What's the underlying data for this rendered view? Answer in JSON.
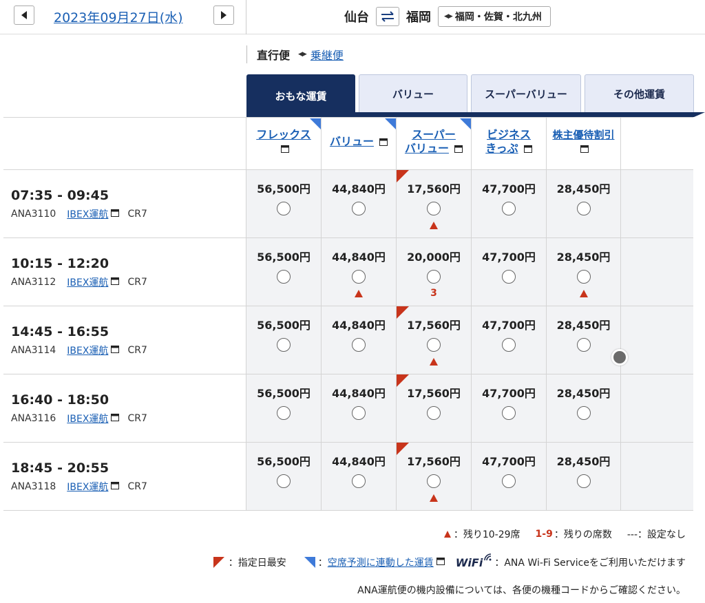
{
  "header": {
    "date": "2023年09月27日(水)",
    "origin": "仙台",
    "destination": "福岡",
    "area_option": "福岡・佐賀・北九州"
  },
  "flight_type": {
    "direct": "直行便",
    "transfer": "乗継便"
  },
  "tabs": [
    "おもな運賃",
    "バリュー",
    "スーパーバリュー",
    "その他運賃"
  ],
  "fare_headers": [
    {
      "line1": "フレックス",
      "line2": ""
    },
    {
      "line1": "バリュー",
      "line2": ""
    },
    {
      "line1": "スーパー",
      "line2": "バリュー"
    },
    {
      "line1": "ビジネス",
      "line2": "きっぷ"
    },
    {
      "line1": "株主優待割引",
      "line2": ""
    }
  ],
  "flights": [
    {
      "time": "07:35 - 09:45",
      "flight_no": "ANA3110",
      "operator": "IBEX運航",
      "aircraft": "CR7",
      "fares": [
        {
          "price": "56,500円",
          "mark": ""
        },
        {
          "price": "44,840円",
          "mark": ""
        },
        {
          "price": "17,560円",
          "mark": "triangle",
          "lowest": true
        },
        {
          "price": "47,700円",
          "mark": ""
        },
        {
          "price": "28,450円",
          "mark": ""
        }
      ]
    },
    {
      "time": "10:15 - 12:20",
      "flight_no": "ANA3112",
      "operator": "IBEX運航",
      "aircraft": "CR7",
      "fares": [
        {
          "price": "56,500円",
          "mark": ""
        },
        {
          "price": "44,840円",
          "mark": "triangle"
        },
        {
          "price": "20,000円",
          "mark": "3"
        },
        {
          "price": "47,700円",
          "mark": ""
        },
        {
          "price": "28,450円",
          "mark": "triangle"
        }
      ]
    },
    {
      "time": "14:45 - 16:55",
      "flight_no": "ANA3114",
      "operator": "IBEX運航",
      "aircraft": "CR7",
      "fares": [
        {
          "price": "56,500円",
          "mark": ""
        },
        {
          "price": "44,840円",
          "mark": ""
        },
        {
          "price": "17,560円",
          "mark": "triangle",
          "lowest": true
        },
        {
          "price": "47,700円",
          "mark": ""
        },
        {
          "price": "28,450円",
          "mark": ""
        }
      ]
    },
    {
      "time": "16:40 - 18:50",
      "flight_no": "ANA3116",
      "operator": "IBEX運航",
      "aircraft": "CR7",
      "fares": [
        {
          "price": "56,500円",
          "mark": ""
        },
        {
          "price": "44,840円",
          "mark": ""
        },
        {
          "price": "17,560円",
          "mark": "",
          "lowest": true
        },
        {
          "price": "47,700円",
          "mark": ""
        },
        {
          "price": "28,450円",
          "mark": ""
        }
      ]
    },
    {
      "time": "18:45 - 20:55",
      "flight_no": "ANA3118",
      "operator": "IBEX運航",
      "aircraft": "CR7",
      "fares": [
        {
          "price": "56,500円",
          "mark": ""
        },
        {
          "price": "44,840円",
          "mark": ""
        },
        {
          "price": "17,560円",
          "mark": "triangle",
          "lowest": true
        },
        {
          "price": "47,700円",
          "mark": ""
        },
        {
          "price": "28,450円",
          "mark": ""
        }
      ]
    }
  ],
  "legend": {
    "triangle_text": "：残り10-29席",
    "count_label": "1-9",
    "count_text": "：残りの席数",
    "none_text": "---：設定なし",
    "lowest_text": "：指定日最安",
    "linked_link": "空席予測に連動した運賃",
    "wifi_label": "WiFi",
    "wifi_text": "：ANA Wi-Fi Serviceをご利用いただけます",
    "note": "ANA運航便の機内設備については、各便の機種コードからご確認ください。"
  },
  "colors": {
    "navy": "#162f5f",
    "link": "#1a5fb4",
    "accent_red": "#c8341b",
    "accent_blue": "#3e7ad9",
    "cell_bg": "#f2f3f5"
  }
}
